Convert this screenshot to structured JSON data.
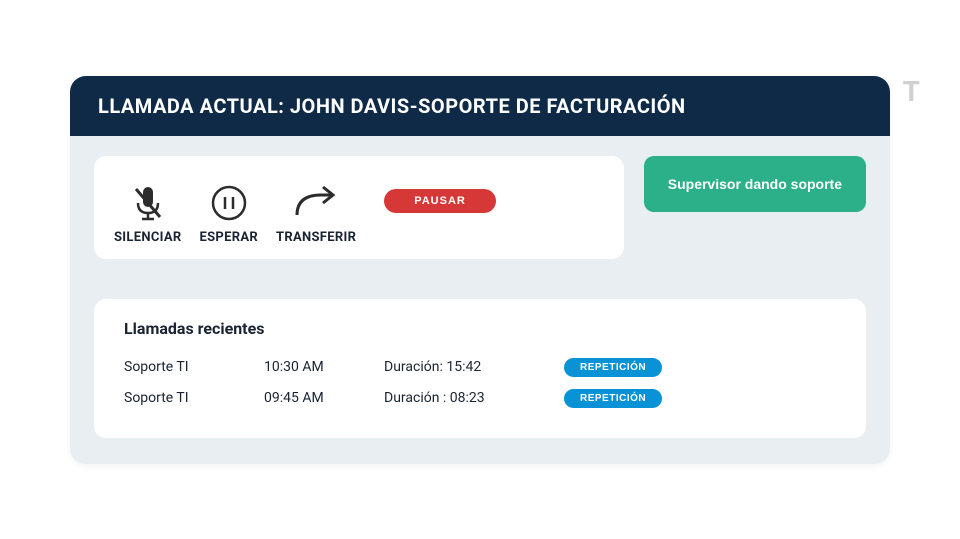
{
  "header": {
    "title": "LLAMADA ACTUAL: JOHN DAVIS-SOPORTE DE FACTURACIÓN"
  },
  "controls": {
    "silenciar_label": "SILENCIAR",
    "esperar_label": "ESPERAR",
    "transferir_label": "TRANSFERIR",
    "pausar_label": "PAUSAR"
  },
  "supervisor_label": "Supervisor dando soporte",
  "recent": {
    "title": "Llamadas recientes",
    "duration_prefix": "Duración",
    "repeat_label": "REPETICIÓN",
    "calls": [
      {
        "type": "Soporte TI",
        "time": "10:30 AM",
        "duration": "15:42"
      },
      {
        "type": "Soporte TI",
        "time": "09:45 AM",
        "duration": "08:23"
      }
    ]
  },
  "watermark_char": "T"
}
